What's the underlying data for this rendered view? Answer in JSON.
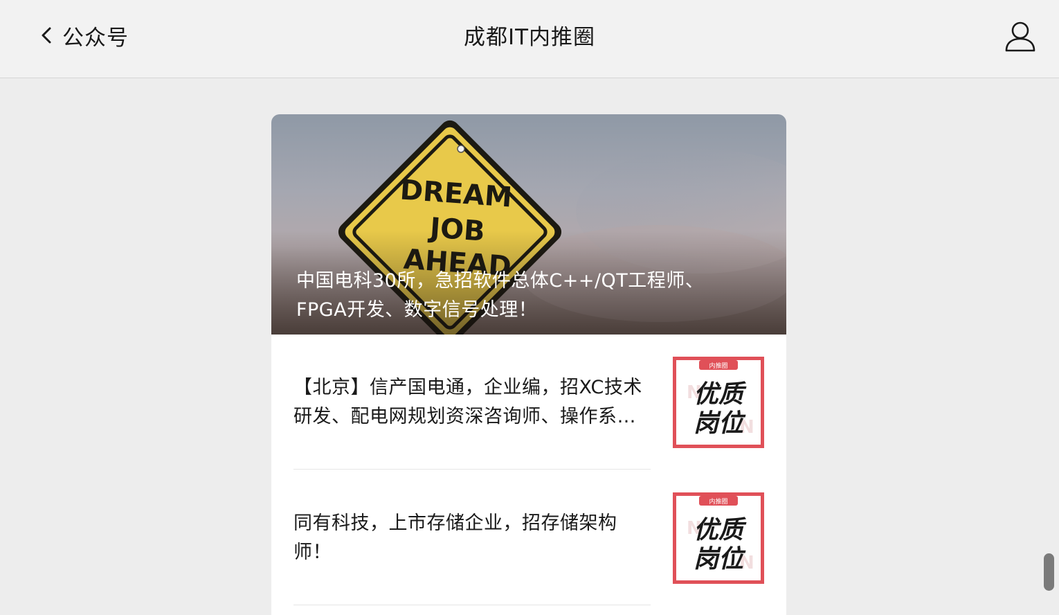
{
  "header": {
    "back_label": "公众号",
    "title": "成都IT内推圈",
    "icons": {
      "back": "chevron-left-icon",
      "profile": "user-profile-icon"
    }
  },
  "hero": {
    "title": "中国电科30所，急招软件总体C++/QT工程师、FPGA开发、数字信号处理！",
    "sign_lines": [
      "DREAM",
      "JOB",
      "AHEAD"
    ]
  },
  "articles": [
    {
      "title": "【北京】信产国电通，企业编，招XC技术研发、配电网规划资深咨询师、操作系统工程师等！",
      "thumb_badge": "内推圈",
      "thumb_lines": [
        "优质",
        "岗位"
      ]
    },
    {
      "title": "同有科技，上市存储企业，招存储架构师！",
      "thumb_badge": "内推圈",
      "thumb_lines": [
        "优质",
        "岗位"
      ]
    }
  ],
  "colors": {
    "sign_yellow": "#e8c94a",
    "thumb_red": "#e05058",
    "page_bg": "#ededed"
  }
}
